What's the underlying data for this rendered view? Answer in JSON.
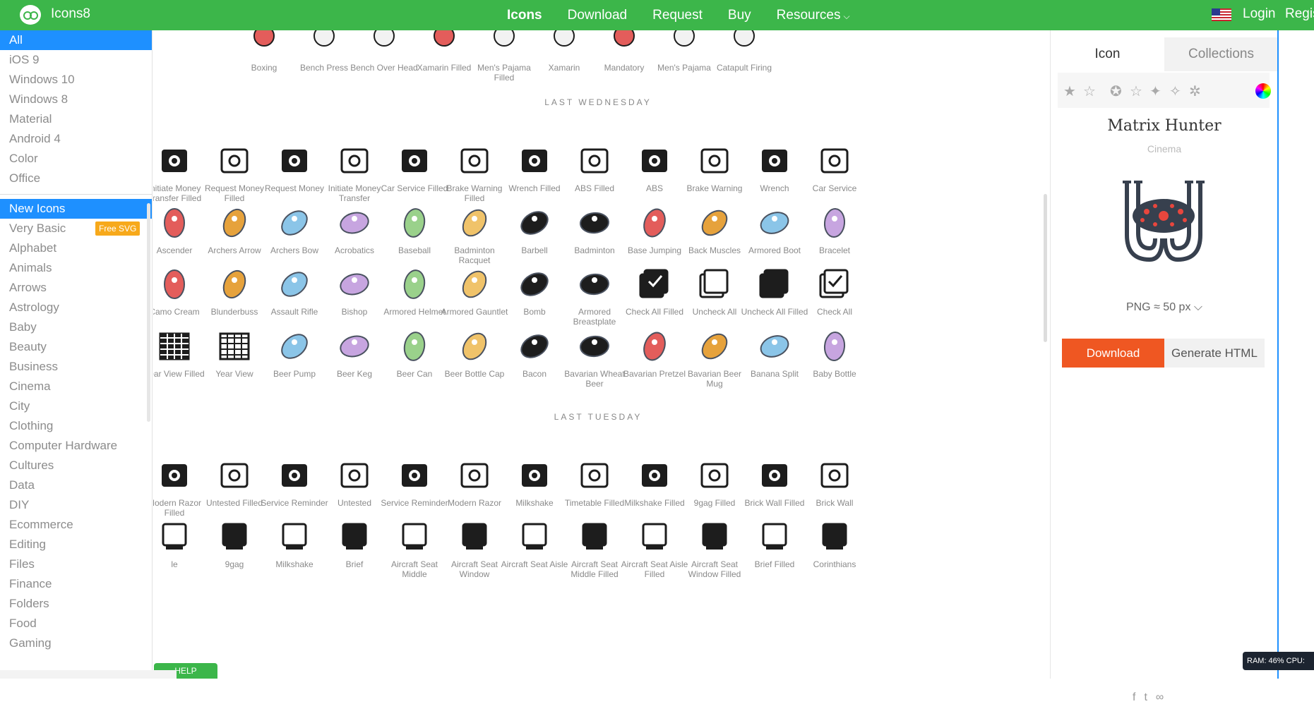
{
  "app": {
    "brand": "Icons8",
    "login": "Login",
    "register": "Regis"
  },
  "nav": [
    "Icons",
    "Download",
    "Request",
    "Buy",
    "Resources"
  ],
  "sidebar": {
    "top": [
      "All",
      "iOS 9",
      "Windows 10",
      "Windows 8",
      "Material",
      "Android 4",
      "Color",
      "Office"
    ],
    "categories": [
      "New Icons",
      "Very Basic",
      "Alphabet",
      "Animals",
      "Arrows",
      "Astrology",
      "Baby",
      "Beauty",
      "Business",
      "Cinema",
      "City",
      "Clothing",
      "Computer Hardware",
      "Cultures",
      "Data",
      "DIY",
      "Ecommerce",
      "Editing",
      "Files",
      "Finance",
      "Folders",
      "Food",
      "Gaming"
    ],
    "badge": "Free SVG"
  },
  "sections": {
    "wednesday": "LAST WEDNESDAY",
    "tuesday": "LAST TUESDAY"
  },
  "rows": {
    "top": [
      "Boxing",
      "Bench Press",
      "Bench Over Head",
      "Xamarin Filled",
      "Men's Pajama Filled",
      "Xamarin",
      "Mandatory",
      "Men's Pajama",
      "Catapult Firing"
    ],
    "r1": [
      "Initiate Money Transfer Filled",
      "Request Money Filled",
      "Request Money",
      "Initiate Money Transfer",
      "Car Service Filled",
      "Brake Warning Filled",
      "Wrench Filled",
      "ABS Filled",
      "ABS",
      "Brake Warning",
      "Wrench",
      "Car Service"
    ],
    "r2": [
      "Ascender",
      "Archers Arrow",
      "Archers Bow",
      "Acrobatics",
      "Baseball",
      "Badminton Racquet",
      "Barbell",
      "Badminton",
      "Base Jumping",
      "Back Muscles",
      "Armored Boot",
      "Bracelet"
    ],
    "r3": [
      "Camo Cream",
      "Blunderbuss",
      "Assault Rifle",
      "Bishop",
      "Armored Helmet",
      "Armored Gauntlet",
      "Bomb",
      "Armored Breastplate",
      "Check All Filled",
      "Uncheck All",
      "Uncheck All Filled",
      "Check All"
    ],
    "r4": [
      "Year View Filled",
      "Year View",
      "Beer Pump",
      "Beer Keg",
      "Beer Can",
      "Beer Bottle Cap",
      "Bacon",
      "Bavarian Wheat Beer",
      "Bavarian Pretzel",
      "Bavarian Beer Mug",
      "Banana Split",
      "Baby Bottle"
    ],
    "r5": [
      "Modern Razor Filled",
      "Untested Filled",
      "Service Reminder",
      "Untested",
      "Service Reminder",
      "Modern Razor",
      "Milkshake",
      "Timetable Filled",
      "Milkshake Filled",
      "9gag Filled",
      "Brick Wall Filled",
      "Brick Wall"
    ],
    "r6": [
      "le",
      "9gag",
      "Milkshake",
      "Brief",
      "Aircraft Seat Middle",
      "Aircraft Seat Window",
      "Aircraft Seat Aisle",
      "Aircraft Seat Middle Filled",
      "Aircraft Seat Aisle Filled",
      "Aircraft Seat Window Filled",
      "Brief Filled",
      "Corinthians"
    ]
  },
  "panel": {
    "tab_icon": "Icon",
    "tab_collections": "Collections",
    "title": "Matrix Hunter",
    "subtitle": "Cinema",
    "format": "PNG ≈ 50 px",
    "download": "Download",
    "generate": "Generate HTML"
  },
  "status": "RAM: 46%  CPU:",
  "help": "HELP",
  "accent": "#3cb64a",
  "selection": "#1e90ff",
  "download_color": "#ef5722"
}
